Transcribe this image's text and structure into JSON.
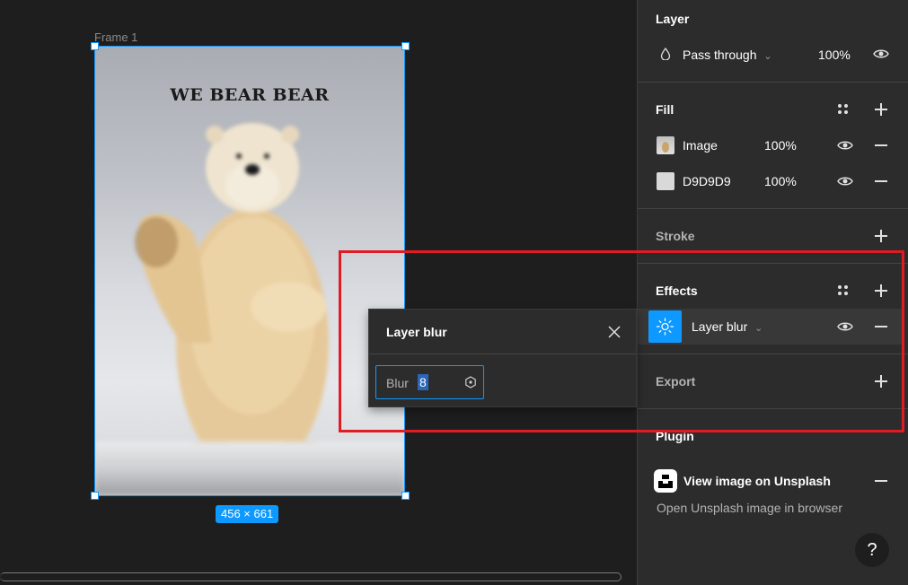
{
  "canvas": {
    "frame_label": "Frame 1",
    "frame_title": "WE BEAR BEAR",
    "size_badge": "456 × 661"
  },
  "layer": {
    "title": "Layer",
    "blend_mode": "Pass through",
    "opacity": "100%"
  },
  "fill": {
    "title": "Fill",
    "items": [
      {
        "name": "Image",
        "opacity": "100%"
      },
      {
        "name": "D9D9D9",
        "opacity": "100%",
        "color": "#D9D9D9"
      }
    ]
  },
  "stroke": {
    "title": "Stroke"
  },
  "effects": {
    "title": "Effects",
    "item": {
      "name": "Layer blur"
    }
  },
  "export": {
    "title": "Export"
  },
  "plugin": {
    "title": "Plugin",
    "name": "View image on Unsplash",
    "description": "Open Unsplash image in browser"
  },
  "popup": {
    "title": "Layer blur",
    "field_label": "Blur",
    "field_value": "8"
  },
  "help_label": "?",
  "colors": {
    "accent": "#0d99ff",
    "highlight": "#e01b24",
    "panel_bg": "#2c2c2c",
    "canvas_bg": "#1e1e1e"
  }
}
